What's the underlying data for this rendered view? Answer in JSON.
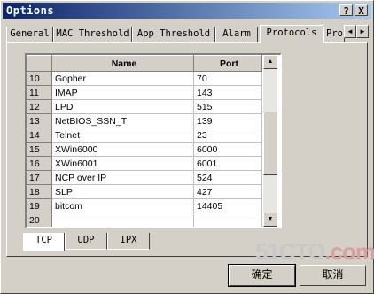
{
  "window": {
    "title": "Options",
    "help_label": "?",
    "close_label": "X"
  },
  "tabs": [
    {
      "label": "General"
    },
    {
      "label": "MAC Threshold"
    },
    {
      "label": "App Threshold"
    },
    {
      "label": "Alarm"
    },
    {
      "label": "Protocols",
      "active": true
    },
    {
      "label": "Pro"
    }
  ],
  "tab_scroll": {
    "left": "◄",
    "right": "►"
  },
  "grid": {
    "columns": [
      "Name",
      "Port"
    ],
    "rows": [
      {
        "num": "10",
        "name": "Gopher",
        "port": "70"
      },
      {
        "num": "11",
        "name": "IMAP",
        "port": "143"
      },
      {
        "num": "12",
        "name": "LPD",
        "port": "515"
      },
      {
        "num": "13",
        "name": "NetBIOS_SSN_T",
        "port": "139"
      },
      {
        "num": "14",
        "name": "Telnet",
        "port": "23"
      },
      {
        "num": "15",
        "name": "XWin6000",
        "port": "6000"
      },
      {
        "num": "16",
        "name": "XWin6001",
        "port": "6001"
      },
      {
        "num": "17",
        "name": "NCP over IP",
        "port": "524"
      },
      {
        "num": "18",
        "name": "SLP",
        "port": "427"
      },
      {
        "num": "19",
        "name": "bitcom",
        "port": "14405"
      },
      {
        "num": "20",
        "name": "",
        "port": ""
      }
    ],
    "scroll_up": "▲",
    "scroll_down": "▼"
  },
  "bottom_tabs": [
    {
      "label": "TCP",
      "active": true
    },
    {
      "label": "UDP"
    },
    {
      "label": "IPX"
    }
  ],
  "buttons": {
    "ok": "确定",
    "cancel": "取消"
  },
  "watermark": {
    "main_gray": "51CTO",
    "main_red": ".com",
    "sub": "技术成就梦想"
  }
}
